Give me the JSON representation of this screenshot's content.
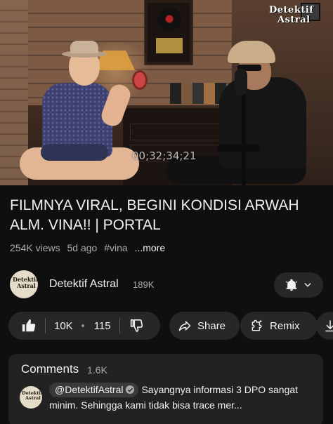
{
  "video": {
    "timecode": "00;32;34;21",
    "brand_logo_line1": "Detektif",
    "brand_logo_line2": "Astral"
  },
  "title": "FILMNYA VIRAL, BEGINI KONDISI ARWAH ALM. VINA!! | PORTAL",
  "meta": {
    "views": "254K views",
    "age": "5d ago",
    "hashtag": "#vina",
    "more": "...more"
  },
  "channel": {
    "name": "Detektif Astral",
    "subscribers": "189K",
    "avatar_text_1": "Detektif",
    "avatar_text_2": "Astral",
    "bell_icon": "bell-icon"
  },
  "actions": {
    "likes": "10K",
    "dislikes": "115",
    "share": "Share",
    "remix": "Remix"
  },
  "comments": {
    "header": "Comments",
    "count": "1.6K",
    "top_comment": {
      "author": "@DetektifAstral",
      "text": "Sayangnya informasi 3 DPO sangat minim. Sehingga kami tidak bisa trace mer..."
    }
  }
}
